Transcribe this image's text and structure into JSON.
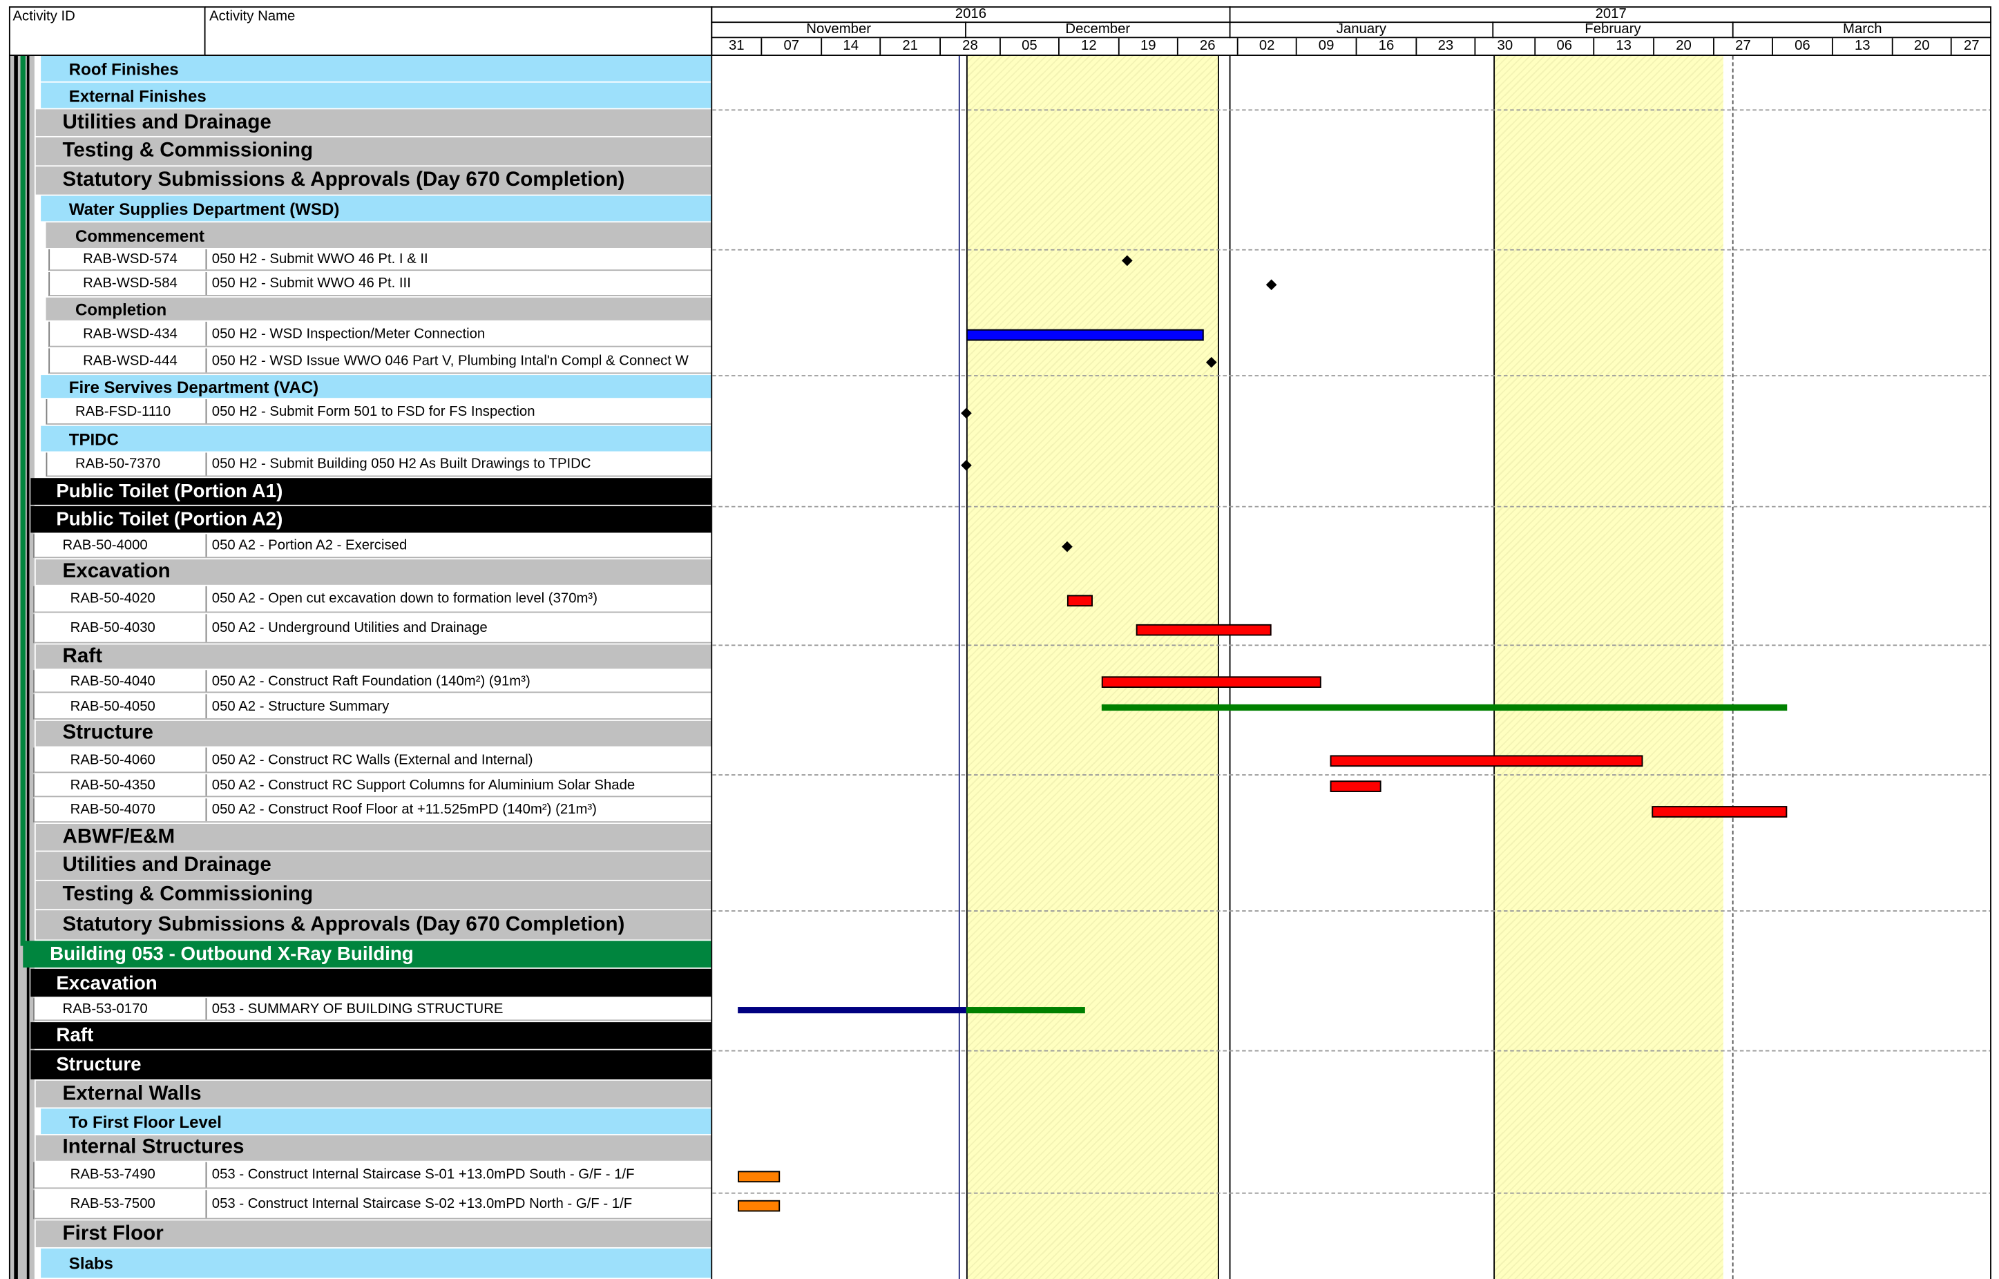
{
  "header": {
    "col_activity_id": "Activity ID",
    "col_activity_name": "Activity Name",
    "years": [
      "2016",
      "2017"
    ],
    "months": [
      "November",
      "December",
      "January",
      "February",
      "March"
    ],
    "weeks": [
      "31",
      "07",
      "14",
      "21",
      "28",
      "05",
      "12",
      "19",
      "26",
      "02",
      "09",
      "16",
      "23",
      "30",
      "06",
      "13",
      "20",
      "27",
      "06",
      "13",
      "20",
      "27"
    ]
  },
  "colors": {
    "grey_band": "#c0c0c0",
    "blue_band": "#9de0fb",
    "black_band": "#000000",
    "green_band": "#00853e",
    "holiday_shade": "#ffffc0",
    "bar_red": "#ff0000",
    "bar_blue": "#0000ff",
    "bar_navy": "#000080",
    "bar_green": "#008000",
    "bar_orange": "#ff8000"
  },
  "rows": [
    {
      "type": "band",
      "style": "blue",
      "label": "Roof Finishes"
    },
    {
      "type": "band",
      "style": "blue",
      "label": "External Finishes"
    },
    {
      "type": "band",
      "style": "grey",
      "label": "Utilities and Drainage"
    },
    {
      "type": "band",
      "style": "grey",
      "label": "Testing & Commissioning"
    },
    {
      "type": "band",
      "style": "grey",
      "label": "Statutory Submissions & Approvals (Day 670 Completion)"
    },
    {
      "type": "band",
      "style": "blue",
      "label": "Water Supplies Department (WSD)"
    },
    {
      "type": "band",
      "style": "grey",
      "label": "Commencement"
    },
    {
      "type": "activity",
      "id": "RAB-WSD-574",
      "name": "050 H2 - Submit WWO 46 Pt. I & II"
    },
    {
      "type": "activity",
      "id": "RAB-WSD-584",
      "name": "050 H2 - Submit WWO 46 Pt. III"
    },
    {
      "type": "band",
      "style": "grey",
      "label": "Completion"
    },
    {
      "type": "activity",
      "id": "RAB-WSD-434",
      "name": "050 H2 - WSD Inspection/Meter Connection"
    },
    {
      "type": "activity",
      "id": "RAB-WSD-444",
      "name": "050 H2 - WSD Issue WWO 046 Part V, Plumbing Intal'n Compl &  Connect W"
    },
    {
      "type": "band",
      "style": "blue",
      "label": "Fire Servives Department (VAC)"
    },
    {
      "type": "activity",
      "id": "RAB-FSD-1110",
      "name": "050 H2 - Submit Form 501 to FSD for FS Inspection"
    },
    {
      "type": "band",
      "style": "blue",
      "label": "TPIDC"
    },
    {
      "type": "activity",
      "id": "RAB-50-7370",
      "name": "050 H2 - Submit Building 050 H2 As Built Drawings to TPIDC"
    },
    {
      "type": "band",
      "style": "black",
      "label": "Public Toilet (Portion A1)"
    },
    {
      "type": "band",
      "style": "black",
      "label": "Public Toilet (Portion A2)"
    },
    {
      "type": "activity",
      "id": "RAB-50-4000",
      "name": "050 A2 - Portion A2 - Exercised"
    },
    {
      "type": "band",
      "style": "grey",
      "label": "Excavation"
    },
    {
      "type": "activity",
      "id": "RAB-50-4020",
      "name": "050 A2 - Open cut excavation down to formation level (370m³)"
    },
    {
      "type": "activity",
      "id": "RAB-50-4030",
      "name": "050 A2 - Underground Utilities and Drainage"
    },
    {
      "type": "band",
      "style": "grey",
      "label": "Raft"
    },
    {
      "type": "activity",
      "id": "RAB-50-4040",
      "name": "050 A2 - Construct Raft Foundation (140m²) (91m³)"
    },
    {
      "type": "activity",
      "id": "RAB-50-4050",
      "name": "050 A2 - Structure Summary"
    },
    {
      "type": "band",
      "style": "grey",
      "label": "Structure"
    },
    {
      "type": "activity",
      "id": "RAB-50-4060",
      "name": "050 A2 - Construct RC Walls (External and Internal)"
    },
    {
      "type": "activity",
      "id": "RAB-50-4350",
      "name": "050 A2 - Construct RC Support Columns for Aluminium Solar Shade"
    },
    {
      "type": "activity",
      "id": "RAB-50-4070",
      "name": "050 A2 - Construct Roof Floor at +11.525mPD (140m²) (21m³)"
    },
    {
      "type": "band",
      "style": "grey",
      "label": "ABWF/E&M"
    },
    {
      "type": "band",
      "style": "grey",
      "label": "Utilities and Drainage"
    },
    {
      "type": "band",
      "style": "grey",
      "label": "Testing & Commissioning"
    },
    {
      "type": "band",
      "style": "grey",
      "label": "Statutory Submissions & Approvals (Day 670 Completion)"
    },
    {
      "type": "band",
      "style": "green",
      "label": "Building 053 - Outbound X-Ray Building"
    },
    {
      "type": "band",
      "style": "black",
      "label": "Excavation"
    },
    {
      "type": "activity",
      "id": "RAB-53-0170",
      "name": "053 - SUMMARY OF BUILDING STRUCTURE"
    },
    {
      "type": "band",
      "style": "black",
      "label": "Raft"
    },
    {
      "type": "band",
      "style": "black",
      "label": "Structure"
    },
    {
      "type": "band",
      "style": "grey",
      "label": "External Walls"
    },
    {
      "type": "band",
      "style": "blue",
      "label": "To First Floor Level"
    },
    {
      "type": "band",
      "style": "grey",
      "label": "Internal Structures"
    },
    {
      "type": "activity",
      "id": "RAB-53-7490",
      "name": "053 - Construct Internal Staircase S-01 +13.0mPD South - G/F - 1/F"
    },
    {
      "type": "activity",
      "id": "RAB-53-7500",
      "name": "053 - Construct Internal Staircase S-02 +13.0mPD North - G/F - 1/F"
    },
    {
      "type": "band",
      "style": "grey",
      "label": "First Floor"
    },
    {
      "type": "band",
      "style": "blue",
      "label": "Slabs"
    }
  ],
  "gantt": {
    "milestones": [
      {
        "activity": "RAB-WSD-574",
        "date": "2016-12-16"
      },
      {
        "activity": "RAB-WSD-584",
        "date": "2017-01-02"
      },
      {
        "activity": "RAB-WSD-444",
        "date": "2016-12-26"
      },
      {
        "activity": "RAB-FSD-1110",
        "date": "2016-11-27"
      },
      {
        "activity": "RAB-50-7370",
        "date": "2016-11-27"
      },
      {
        "activity": "RAB-50-4000",
        "date": "2016-12-09"
      }
    ],
    "bars": [
      {
        "activity": "RAB-WSD-434",
        "start": "2016-11-27",
        "end": "2016-12-25",
        "color": "bar_blue"
      },
      {
        "activity": "RAB-50-4020",
        "start": "2016-12-09",
        "end": "2016-12-12",
        "color": "bar_red"
      },
      {
        "activity": "RAB-50-4030",
        "start": "2016-12-17",
        "end": "2017-01-02",
        "color": "bar_red"
      },
      {
        "activity": "RAB-50-4040",
        "start": "2016-12-13",
        "end": "2017-01-08",
        "color": "bar_red"
      },
      {
        "activity": "RAB-50-4050",
        "start": "2016-12-13",
        "end": "2017-03-04",
        "color": "bar_green"
      },
      {
        "activity": "RAB-50-4060",
        "start": "2017-01-09",
        "end": "2017-02-15",
        "color": "bar_red"
      },
      {
        "activity": "RAB-50-4350",
        "start": "2017-01-09",
        "end": "2017-01-15",
        "color": "bar_red"
      },
      {
        "activity": "RAB-50-4070",
        "start": "2017-02-16",
        "end": "2017-03-04",
        "color": "bar_red"
      },
      {
        "activity": "RAB-53-0170",
        "start": "2016-10-31",
        "end": "2016-11-27",
        "color": "bar_navy"
      },
      {
        "activity": "RAB-53-0170",
        "start": "2016-11-27",
        "end": "2016-12-11",
        "color": "bar_green"
      },
      {
        "activity": "RAB-53-7490",
        "start": "2016-10-31",
        "end": "2016-11-05",
        "color": "bar_orange"
      },
      {
        "activity": "RAB-53-7500",
        "start": "2016-10-31",
        "end": "2016-11-05",
        "color": "bar_orange"
      }
    ]
  }
}
